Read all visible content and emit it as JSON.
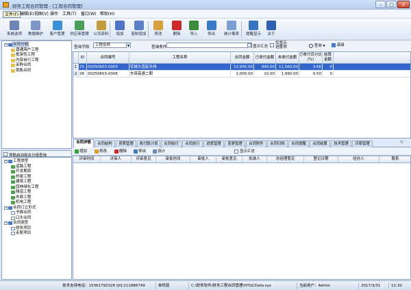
{
  "window": {
    "title": "财务工程合同管理 - [工程合同管理]",
    "min": "–",
    "max": "□",
    "close": "×"
  },
  "menu": [
    {
      "label": "文件(F)",
      "active": true
    },
    {
      "label": "编辑(E)"
    },
    {
      "label": "视图(V)"
    },
    {
      "label": "操作"
    },
    {
      "label": "工具(T)"
    },
    {
      "label": "窗口(W)"
    },
    {
      "label": "帮助(H)"
    }
  ],
  "toolbar": [
    {
      "label": "系统选项",
      "icon": "gear-icon",
      "color": "#6d86b5"
    },
    {
      "label": "数据维护",
      "icon": "database-icon",
      "color": "#7d97c6"
    },
    {
      "label": "客户管理",
      "icon": "customer-icon",
      "color": "#3d8fd6"
    },
    {
      "label": "供应商管理",
      "icon": "supplier-icon",
      "color": "#4aa05a"
    },
    {
      "label": "公司资料",
      "icon": "company-icon",
      "color": "#c59b3f"
    },
    {
      "label": "增加",
      "icon": "add-icon",
      "color": "#4f73c7"
    },
    {
      "label": "复制增加",
      "icon": "copy-add-icon",
      "color": "#5d7fc7"
    },
    {
      "label": "修改",
      "icon": "edit-icon",
      "color": "#d6a041"
    },
    {
      "label": "删除",
      "icon": "delete-icon",
      "color": "#cc2a2a"
    },
    {
      "label": "导入",
      "icon": "import-icon",
      "color": "#3c8a3c"
    },
    {
      "label": "导出",
      "icon": "export-icon",
      "color": "#3a7ac4"
    },
    {
      "label": "统计报表",
      "icon": "report-icon",
      "color": "#7a9fd0"
    },
    {
      "label": "提醒显示",
      "icon": "reminder-icon",
      "color": "#3a75c4"
    },
    {
      "label": "关于",
      "icon": "help-icon",
      "color": "#2f5fb3"
    }
  ],
  "tree_top": [
    {
      "label": "合同分组",
      "level": 0,
      "expander": "−",
      "icon": "blue"
    },
    {
      "label": "普通用户工程",
      "level": 1,
      "icon": "yellow"
    },
    {
      "label": "框架性工程",
      "level": 1,
      "icon": "yellow"
    },
    {
      "label": "内部自行工程",
      "level": 1,
      "icon": "yellow"
    },
    {
      "label": "采购合同",
      "level": 1,
      "icon": "yellow"
    },
    {
      "label": "销售合同",
      "level": 1,
      "icon": "yellow"
    }
  ],
  "tree_bottom_header": "导航启动组合分组查询",
  "tree_bottom": [
    {
      "label": "工程类型",
      "level": 0,
      "expander": "−",
      "icon": "blue"
    },
    {
      "label": "道路工程",
      "level": 1,
      "icon": "green"
    },
    {
      "label": "开发期资",
      "level": 1,
      "icon": "green"
    },
    {
      "label": "桥梁工程",
      "level": 1,
      "icon": "green"
    },
    {
      "label": "建筑工程",
      "level": 1,
      "icon": "green"
    },
    {
      "label": "园林绿化工程",
      "level": 1,
      "icon": "green"
    },
    {
      "label": "隧道工程",
      "level": 1,
      "icon": "green"
    },
    {
      "label": "市政工程",
      "level": 1,
      "icon": "green"
    },
    {
      "label": "机电工程",
      "level": 1,
      "icon": "green"
    },
    {
      "label": "合同订立形式",
      "level": 0,
      "expander": "−",
      "icon": "blue"
    },
    {
      "label": "书面合同",
      "level": 1,
      "icon": "doc"
    },
    {
      "label": "口头合同",
      "level": 1,
      "icon": "doc"
    },
    {
      "label": "合同类型",
      "level": 0,
      "expander": "−",
      "icon": "blue"
    },
    {
      "label": "财务项目",
      "level": 1,
      "icon": "doc"
    },
    {
      "label": "走账项目",
      "level": 1,
      "icon": "doc"
    }
  ],
  "filter": {
    "field_label": "查询字段",
    "field_value": "工程名称",
    "cond_label": "查询条件",
    "cond_value": "",
    "summary": "显示汇总",
    "only_show": "仅显示\n进度项",
    "search": "查询",
    "advanced": "高级"
  },
  "main_grid": {
    "columns": [
      "",
      "ID",
      "合同编号",
      "工程名称",
      "合同金额",
      "已收付金额",
      "未收付金额",
      "已收付百分比(%)",
      "结算金额"
    ],
    "rows": [
      {
        "marker": "1",
        "id": "25",
        "code": "00250603-0005",
        "name": "宏城大道延长线",
        "amount": "12,000.00",
        "paid": "440.00",
        "unpaid": "11,560.00",
        "pct": "3.66",
        "settle": "0"
      },
      {
        "marker": "2",
        "id": "26",
        "code": "00250603-0006",
        "name": "东穿高速二期",
        "amount": "2,000.00",
        "paid": "10.00",
        "unpaid": "1,990.00",
        "pct": "0.50",
        "settle": "0"
      }
    ]
  },
  "tabs": [
    "合同详情",
    "合同结构",
    "资质管理",
    "收付款计划",
    "合同收付",
    "合同执行",
    "进度管理",
    "变更管理",
    "合同附件",
    "合同归档",
    "合同提醒",
    "合同结算",
    "技术管理",
    "印章管理"
  ],
  "sub_toolbar": [
    {
      "label": "增加",
      "color": "#3a9a3a"
    },
    {
      "label": "修改",
      "color": "#d69a2e"
    },
    {
      "label": "删除",
      "color": "#cc2a2a"
    },
    {
      "label": "导出",
      "color": "#3a7ac4"
    },
    {
      "label": "设计",
      "color": "#6f86b3"
    }
  ],
  "sub_summary": "显示汇总",
  "detail_grid": {
    "columns": [
      "评审时间",
      "评审人",
      "评审意见",
      "审批时间",
      "审批人",
      "审批意见",
      "批准人",
      "总经理意见",
      "登记日期",
      "经办人",
      "联系"
    ]
  },
  "status": {
    "support": "技术支持电话：15361792328 QQ:111886749",
    "mode": "单机版",
    "path": "C:\\财务软件\\财务工程合同管理\\HTGCData.sys",
    "user": "当前用户：Admin",
    "date": "2017/3/31",
    "time": "11:32"
  },
  "colors": {
    "selected_row": "#3366cc",
    "accent": "#4b79c9"
  }
}
